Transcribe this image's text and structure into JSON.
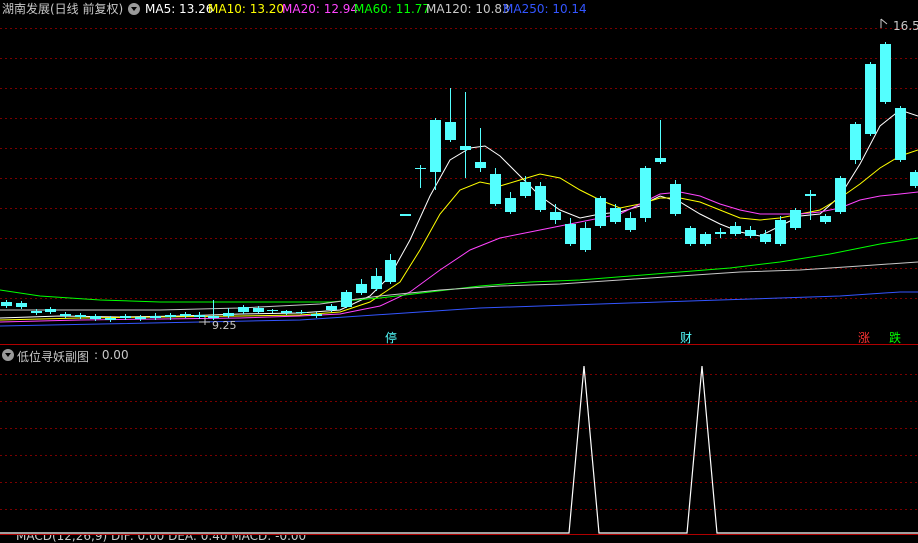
{
  "header": {
    "stock_title": "湖南发展(日线 前复权)",
    "ma_items": [
      {
        "label": "MA5: 13.26",
        "color": "#ffffff"
      },
      {
        "label": "MA10: 13.20",
        "color": "#ffff00"
      },
      {
        "label": "MA20: 12.94",
        "color": "#ff44ff"
      },
      {
        "label": "MA60: 11.77",
        "color": "#00ff00"
      },
      {
        "label": "MA120: 10.83",
        "color": "#c8c8c8"
      },
      {
        "label": "MA250: 10.14",
        "color": "#3355ff"
      }
    ]
  },
  "price_labels": {
    "high": "16.5",
    "low": "9.25"
  },
  "event_badges": {
    "stop": "停",
    "finance": "财",
    "limit_up": "涨",
    "limit_down": "跌"
  },
  "indicator": {
    "title": "低位寻妖副图",
    "value": ": 0.00",
    "signals": [
      1,
      1
    ]
  },
  "bottom_header": {
    "text": "MACD(12,26,9) DIF: 0.00  DEA: 0.40  MACD: -0.00"
  },
  "colors": {
    "up": "#ff3333",
    "down": "#54ffff",
    "grid": "#7a0000",
    "separator": "#b00000"
  }
}
